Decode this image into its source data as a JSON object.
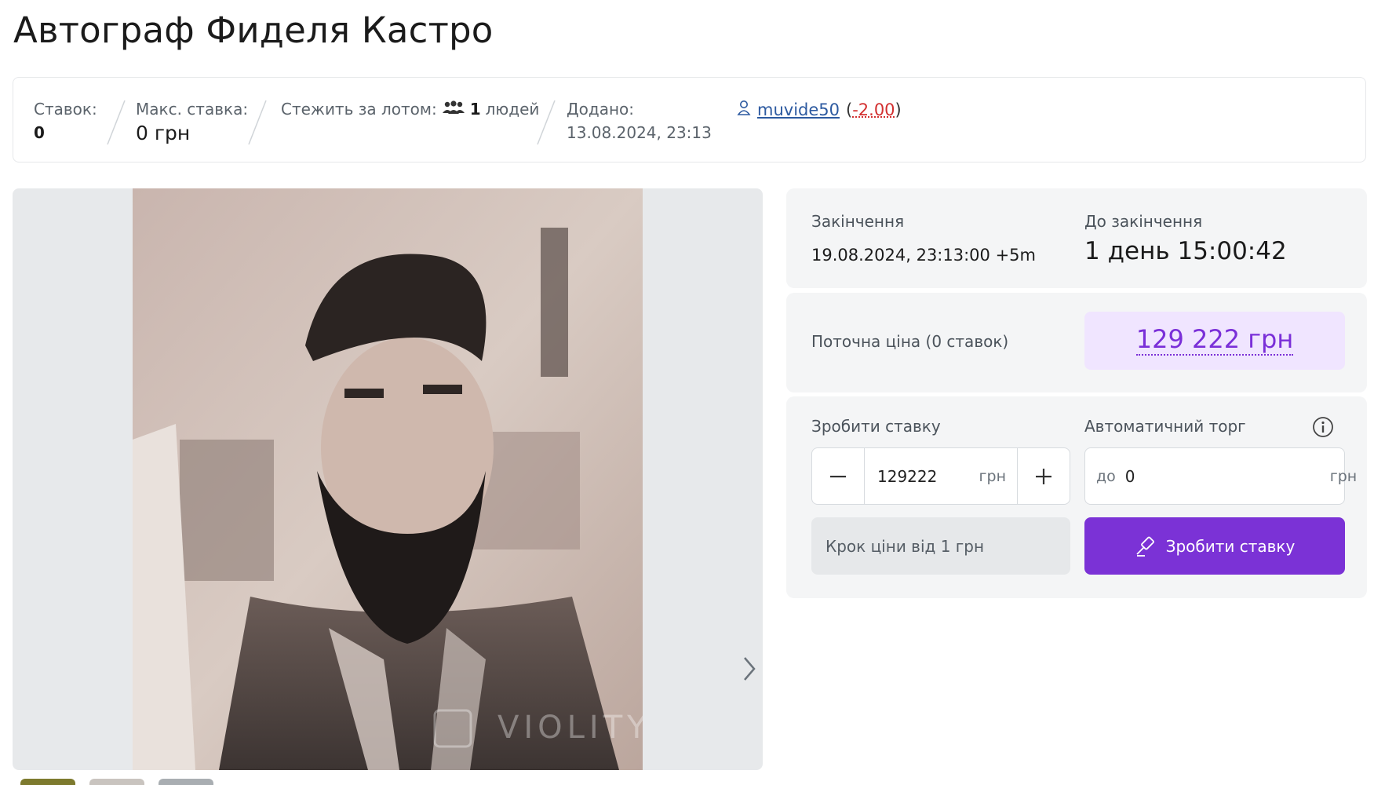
{
  "lot": {
    "title": "Автограф Фиделя Кастро"
  },
  "info": {
    "bids_label": "Ставок:",
    "bids_value": "0",
    "max_bid_label": "Макс. ставка:",
    "max_bid_value": "0 грн",
    "watch_label": "Стежить за лотом:",
    "watch_count": "1",
    "watch_suffix": "людей",
    "added_label": "Додано:",
    "added_value": "13.08.2024, 23:13",
    "seller_name": "muvide50",
    "seller_rating": "-2.00"
  },
  "gallery": {
    "watermark": "VIOLITY",
    "thumb_colors": [
      "#7d7a2e",
      "#c9c4bf",
      "#a9aeb2"
    ]
  },
  "ending": {
    "label": "Закінчення",
    "value": "19.08.2024, 23:13:00 +5m",
    "countdown_label": "До закінчення",
    "countdown_value": "1 день 15:00:42"
  },
  "price": {
    "label": "Поточна ціна (0 ставок)",
    "value": "129 222 грн"
  },
  "bid": {
    "make_bid_label": "Зробити ставку",
    "amount": "129222",
    "unit": "грн",
    "auto_label": "Автоматичний торг",
    "auto_prefix": "до",
    "auto_value": "0",
    "auto_unit": "грн",
    "step_note": "Крок ціни від 1 грн",
    "submit_label": "Зробити ставку"
  },
  "colors": {
    "accent": "#7b32d6",
    "price_bg": "#f0e5ff",
    "negative": "#d33030"
  }
}
